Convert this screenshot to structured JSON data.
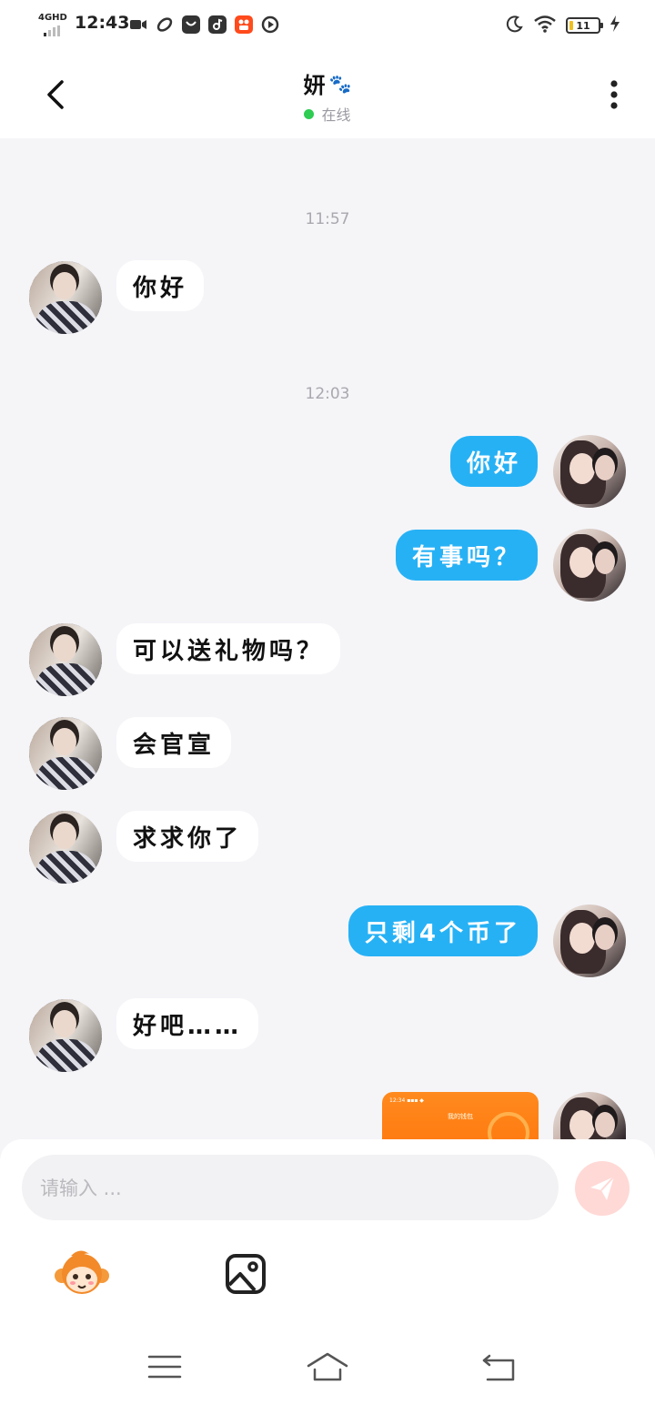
{
  "status_bar": {
    "network": "4GHD",
    "time": "12:43",
    "battery_level": "11",
    "battery_fill_fraction": 0.11,
    "icons": [
      "video-icon",
      "link-icon",
      "shopping-bag-icon",
      "music-app-icon",
      "kuaishou-app-icon",
      "play-icon",
      "moon-icon",
      "wifi-icon",
      "battery-icon",
      "charging-icon"
    ]
  },
  "header": {
    "title": "妍",
    "title_emoji": "🐾",
    "status": "在线"
  },
  "chat": {
    "messages": [
      {
        "type": "timestamp",
        "text": "11:57"
      },
      {
        "type": "text",
        "side": "in",
        "text": "你好"
      },
      {
        "type": "timestamp",
        "text": "12:03"
      },
      {
        "type": "text",
        "side": "out",
        "text": "你好"
      },
      {
        "type": "text",
        "side": "out",
        "text": "有事吗？"
      },
      {
        "type": "text",
        "side": "in",
        "text": "可以送礼物吗？"
      },
      {
        "type": "text",
        "side": "in",
        "text": "会官宣"
      },
      {
        "type": "text",
        "side": "in",
        "text": "求求你了"
      },
      {
        "type": "text",
        "side": "out",
        "text": "只剩4个币了"
      },
      {
        "type": "text",
        "side": "in",
        "text": "好吧……"
      },
      {
        "type": "image",
        "side": "out",
        "text": "我的钱包"
      }
    ]
  },
  "input": {
    "placeholder": "请输入 ..."
  },
  "colors": {
    "outgoing_bubble": "#27b1f5",
    "incoming_bubble": "#ffffff",
    "background": "#f5f5f8",
    "online": "#2ecc52",
    "send_button": "#ffd9d6"
  }
}
